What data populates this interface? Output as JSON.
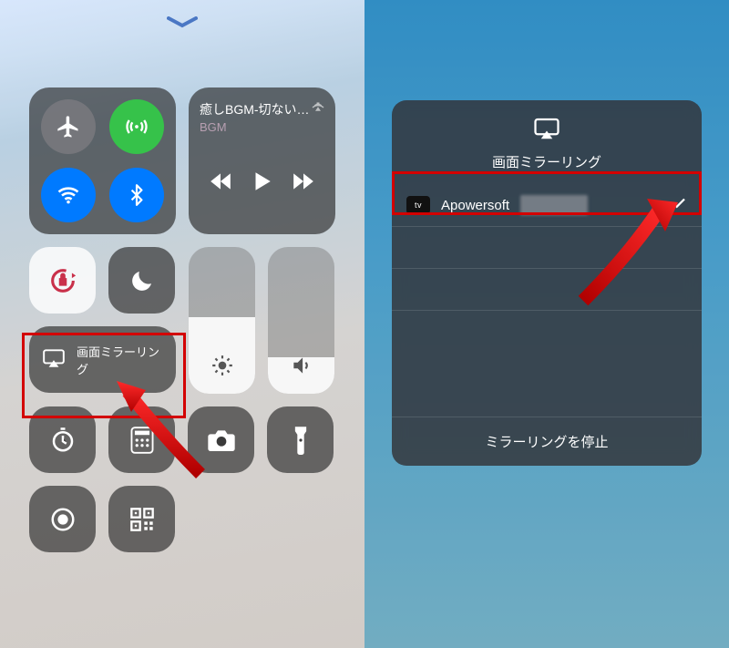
{
  "left": {
    "media": {
      "title": "癒しBGM-切ない…",
      "subtitle": "BGM"
    },
    "mirror_label": "画面ミラーリング",
    "brightness_pct": 52,
    "volume_pct": 25,
    "icons": {
      "airplane": "airplane-icon",
      "cellular": "cellular-icon",
      "wifi": "wifi-icon",
      "bluetooth": "bluetooth-icon",
      "lock": "rotation-lock-icon",
      "dnd": "moon-icon",
      "timer": "timer-icon",
      "calculator": "calculator-icon",
      "camera": "camera-icon",
      "flashlight": "flashlight-icon",
      "record": "screen-record-icon",
      "qr": "qr-code-icon"
    }
  },
  "right": {
    "title": "画面ミラーリング",
    "device_name": "Apowersoft",
    "stop_label": "ミラーリングを停止"
  },
  "colors": {
    "highlight_red": "#d30000",
    "toggle_green": "#36c24a",
    "toggle_blue": "#007aff"
  }
}
